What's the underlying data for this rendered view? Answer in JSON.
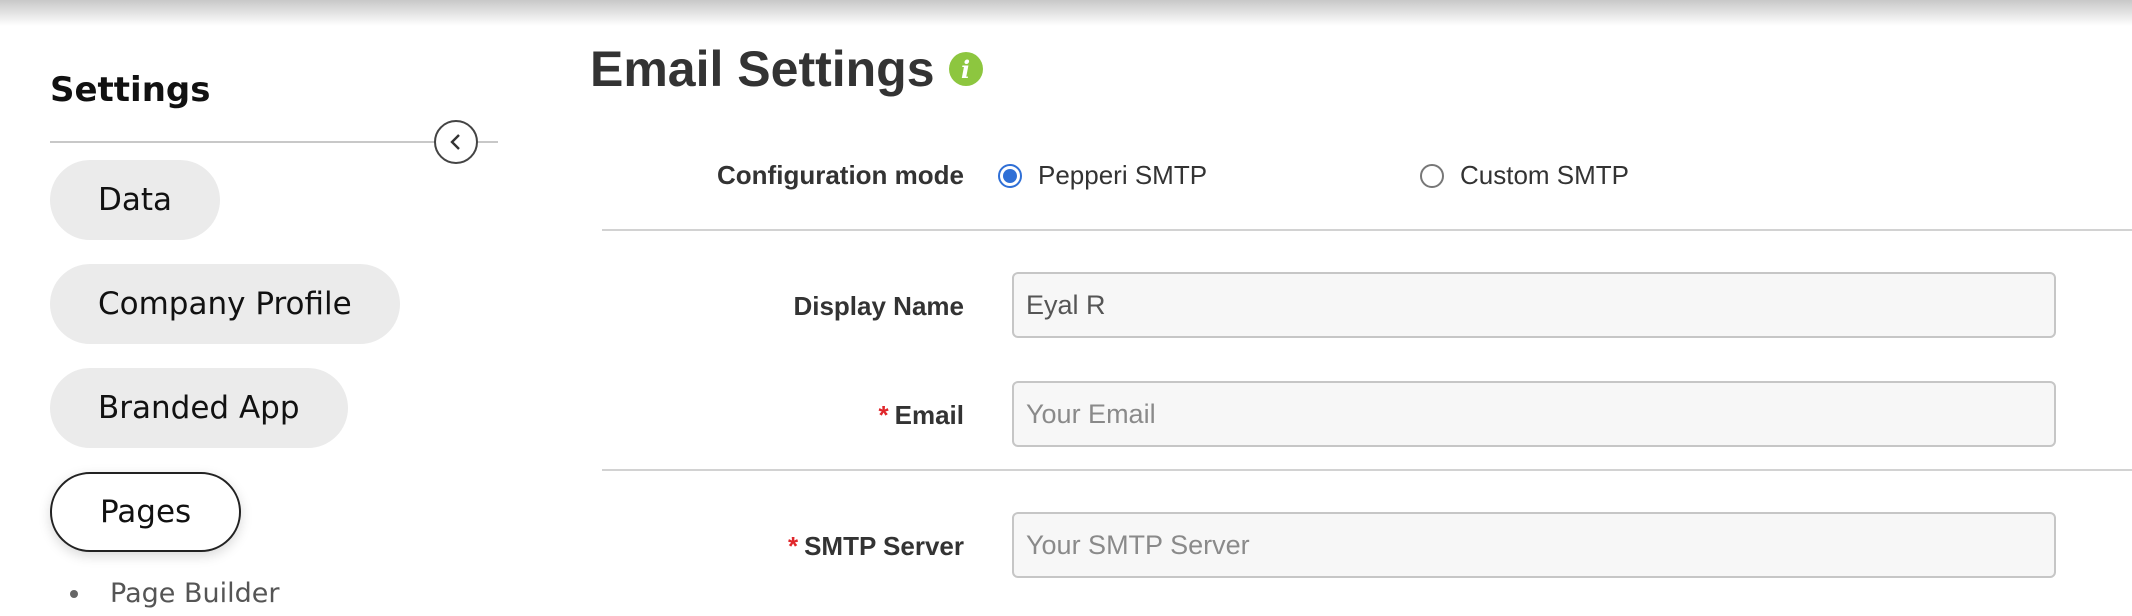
{
  "sidebar": {
    "title": "Settings",
    "items": [
      {
        "label": "Data"
      },
      {
        "label": "Company Profile"
      },
      {
        "label": "Branded App"
      },
      {
        "label": "Pages"
      }
    ],
    "sub_items": [
      {
        "label": "Page Builder"
      }
    ]
  },
  "main": {
    "title": "Email Settings",
    "config_mode": {
      "label": "Configuration mode",
      "options": [
        {
          "label": "Pepperi SMTP",
          "selected": true
        },
        {
          "label": "Custom SMTP",
          "selected": false
        }
      ]
    },
    "display_name": {
      "label": "Display Name",
      "value": "Eyal R",
      "placeholder": ""
    },
    "email": {
      "required_mark": "*",
      "label": "Email",
      "value": "",
      "placeholder": "Your Email"
    },
    "smtp_server": {
      "required_mark": "*",
      "label": "SMTP Server",
      "value": "",
      "placeholder": "Your SMTP Server"
    }
  },
  "colors": {
    "info_icon": "#8dc63f",
    "radio_selected": "#2f6fd6",
    "required": "#e0262b"
  },
  "icons": {
    "collapse": "chevron-left-icon",
    "info": "info-icon"
  }
}
